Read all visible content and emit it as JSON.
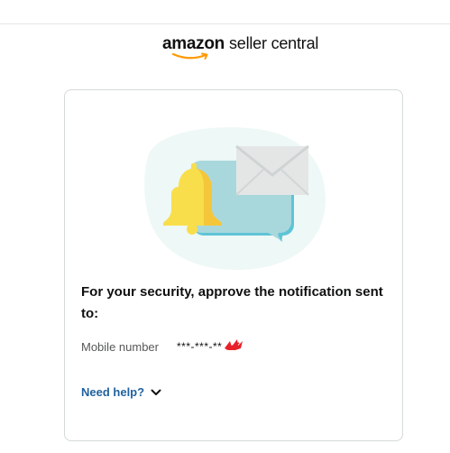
{
  "header": {
    "logo_brand": "amazon",
    "logo_product": "seller central"
  },
  "card": {
    "heading": "For your security, approve the notification sent to:",
    "mobile_label": "Mobile number",
    "mobile_value": "***-***-**",
    "help_label": "Need help?"
  },
  "icons": {
    "illustration": "bell-and-message-envelope-icon",
    "help_toggle": "chevron-down-icon"
  },
  "colors": {
    "link": "#2162a1",
    "bell": "#f9de4b",
    "bubble": "#a9d8dc",
    "blob": "#eef8f6",
    "brand_smile": "#ff9900"
  }
}
